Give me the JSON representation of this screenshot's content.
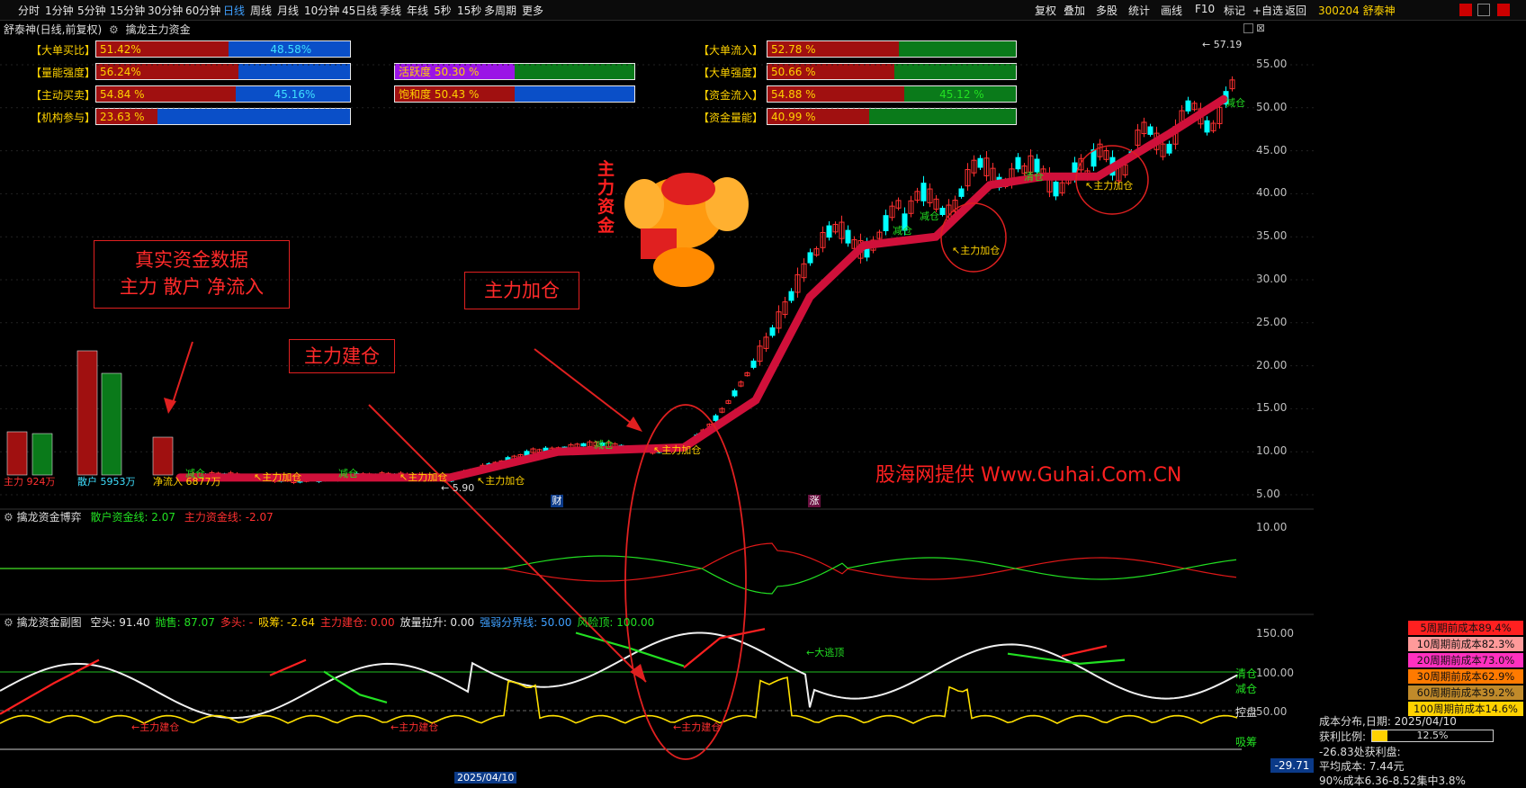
{
  "toolbar": {
    "periods": [
      "分时",
      "1分钟",
      "5分钟",
      "15分钟",
      "30分钟",
      "60分钟",
      "日线",
      "周线",
      "月线",
      "10分钟",
      "45日线",
      "季线",
      "年线",
      "5秒",
      "15秒",
      "多周期",
      "更多"
    ],
    "active": "日线",
    "right_tools": [
      "复权",
      "叠加",
      "多股",
      "统计",
      "画线",
      "F10",
      "标记",
      "+自选",
      "返回"
    ],
    "stock": "300204 舒泰神"
  },
  "title": {
    "stock_name": "舒泰神(日线,前复权)",
    "indicator": "擒龙主力资金"
  },
  "left_bars": [
    {
      "label": "【大单买比】",
      "a": "51.42%",
      "b": "48.58%",
      "split": 0.52
    },
    {
      "label": "【量能强度】",
      "a": "56.24%",
      "b": "",
      "split": 0.56
    },
    {
      "label": "【主动买卖】",
      "a": "54.84 %",
      "b": "45.16%",
      "split": 0.55
    },
    {
      "label": "【机构参与】",
      "a": "23.63 %",
      "b": "",
      "split": 0.24
    }
  ],
  "mid_bars": [
    {
      "label": "",
      "a": "活跃度 50.30 %",
      "b": "",
      "split": 0.5,
      "color": "#9b14e6"
    },
    {
      "label": "",
      "a": "饱和度 50.43 %",
      "b": "",
      "split": 0.5,
      "color": "#a01010"
    }
  ],
  "right_bars": [
    {
      "label": "【大单流入】",
      "a": "52.78 %",
      "b": "",
      "split": 0.53
    },
    {
      "label": "【大单强度】",
      "a": "50.66 %",
      "b": "",
      "split": 0.51
    },
    {
      "label": "【资金流入】",
      "a": "54.88 %",
      "b": "45.12 %",
      "split": 0.55
    },
    {
      "label": "【资金量能】",
      "a": "40.99 %",
      "b": "",
      "split": 0.41
    }
  ],
  "annotations": {
    "box1_line1": "真实资金数据",
    "box1_line2": "主力 散户 净流入",
    "box2": "主力建仓",
    "box3": "主力加仓",
    "vertical_title": "主力资金",
    "watermark": "股海网提供 Www.Guhai.Com.CN"
  },
  "flow": {
    "main_label": "主力",
    "main_value": "924万",
    "retail_label": "散户",
    "retail_value": "5953万",
    "net_label": "净流入",
    "net_value": "6877万"
  },
  "main_chart": {
    "y_axis": [
      "55.00",
      "50.00",
      "45.00",
      "40.00",
      "35.00",
      "30.00",
      "25.00",
      "20.00",
      "15.00",
      "10.00",
      "5.00"
    ],
    "high_label": "57.19",
    "low_label": "5.90",
    "tags": [
      "主力加仓",
      "减仓",
      "清仓",
      "财",
      "涨"
    ]
  },
  "pane2": {
    "title": "擒龙资金博弈",
    "retail_line": "散户资金线: 2.07",
    "main_line": "主力资金线: -2.07",
    "y_axis": [
      "10.00"
    ]
  },
  "pane3": {
    "title": "擒龙资金副图",
    "items": [
      {
        "text": "空头: 91.40",
        "color": "#e6e6e6"
      },
      {
        "text": "抛售: 87.07",
        "color": "#22e022"
      },
      {
        "text": "多头: -",
        "color": "#ff3030"
      },
      {
        "text": "吸筹: -2.64",
        "color": "#ffd200"
      },
      {
        "text": "主力建仓: 0.00",
        "color": "#ff3030"
      },
      {
        "text": "放量拉升: 0.00",
        "color": "#e6e6e6"
      },
      {
        "text": "强弱分界线: 50.00",
        "color": "#3fa0ff"
      },
      {
        "text": "风险顶: 100.00",
        "color": "#22e022"
      }
    ],
    "y_axis": [
      "150.00",
      "100.00",
      "50.00"
    ],
    "current": "-29.71",
    "right_tags": {
      "clear": "清仓",
      "reduce": "减仓",
      "control": "控盘",
      "absorb": "吸筹"
    },
    "labels": {
      "build": "主力建仓",
      "escape": "大逃顶"
    },
    "date": "2025/04/10"
  },
  "cost_panel": {
    "rows": [
      {
        "text": "5周期前成本89.4%",
        "bg": "#ff2020"
      },
      {
        "text": "10周期前成本82.3%",
        "bg": "#ff9a9a"
      },
      {
        "text": "20周期前成本73.0%",
        "bg": "#ff30c0"
      },
      {
        "text": "30周期前成本62.9%",
        "bg": "#ff7a00"
      },
      {
        "text": "60周期前成本39.2%",
        "bg": "#c08a2a"
      },
      {
        "text": "100周期前成本14.6%",
        "bg": "#ffd200"
      }
    ],
    "dist_title": "成本分布,日期: 2025/04/10",
    "profit_label": "获利比例:",
    "profit_value": "12.5%",
    "profit_fraction": 0.125,
    "profit_line": "-26.83处获利盘:",
    "avg_cost": "平均成本: 7.44元",
    "conc": "90%成本6.36-8.52集中3.8%"
  },
  "colors": {
    "up": "#ff3030",
    "down": "#00ffff",
    "ma": "#d0103a",
    "green": "#22e022",
    "yellow": "#ffd200"
  }
}
